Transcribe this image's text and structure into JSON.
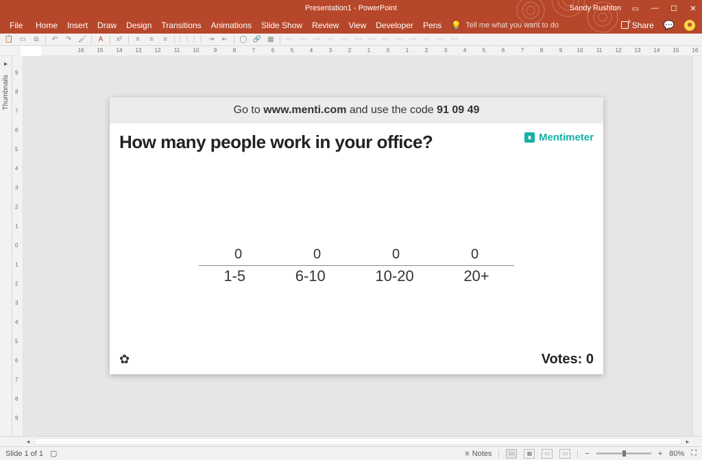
{
  "titlebar": {
    "title": "Presentation1 - PowerPoint",
    "user": "Sandy Rushton"
  },
  "ribbon": {
    "file": "File",
    "tabs": [
      "Home",
      "Insert",
      "Draw",
      "Design",
      "Transitions",
      "Animations",
      "Slide Show",
      "Review",
      "View",
      "Developer",
      "Pens"
    ],
    "tellme": "Tell me what you want to do",
    "share": "Share"
  },
  "thumbs": {
    "label": "Thumbnails"
  },
  "ruler_h": [
    "16",
    "15",
    "14",
    "13",
    "12",
    "11",
    "10",
    "9",
    "8",
    "7",
    "6",
    "5",
    "4",
    "3",
    "2",
    "1",
    "0",
    "1",
    "2",
    "3",
    "4",
    "5",
    "6",
    "7",
    "8",
    "9",
    "10",
    "11",
    "12",
    "13",
    "14",
    "15",
    "16"
  ],
  "ruler_v": [
    "9",
    "8",
    "7",
    "6",
    "5",
    "4",
    "3",
    "2",
    "1",
    "0",
    "1",
    "2",
    "3",
    "4",
    "5",
    "6",
    "7",
    "8",
    "9"
  ],
  "slide": {
    "top_prefix": "Go to ",
    "top_url": "www.menti.com",
    "top_mid": " and use the code ",
    "top_code": "91 09 49",
    "question": "How many people work in your office?",
    "brand": "Mentimeter",
    "votes_label": "Votes: ",
    "votes_value": "0"
  },
  "chart_data": {
    "type": "bar",
    "categories": [
      "1-5",
      "6-10",
      "10-20",
      "20+"
    ],
    "values": [
      0,
      0,
      0,
      0
    ],
    "title": "How many people work in your office?",
    "ylabel": "Votes",
    "xlabel": "",
    "ylim": [
      0,
      1
    ]
  },
  "status": {
    "slide": "Slide 1 of 1",
    "notes": "Notes",
    "zoom": "80%"
  }
}
